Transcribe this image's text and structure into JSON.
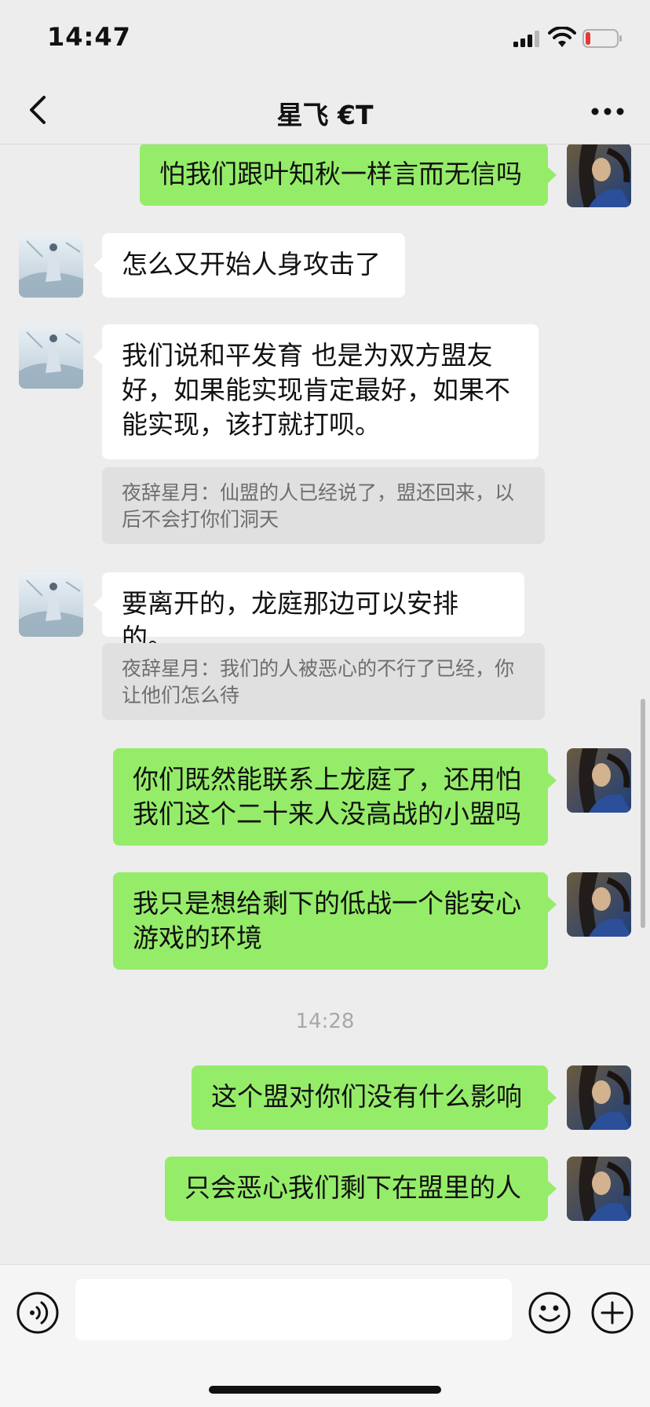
{
  "status_bar": {
    "time": "14:47"
  },
  "header": {
    "title": "星飞 €T"
  },
  "colors": {
    "background": "#ededed",
    "outgoing_bubble": "#95ec69",
    "incoming_bubble": "#ffffff",
    "quote_background": "#e0e0e0",
    "battery_low": "#e53935"
  },
  "icons": {
    "back": "chevron-left-icon",
    "more": "more-dots-icon",
    "voice": "voice-icon",
    "emoji": "emoji-smile-icon",
    "plus": "plus-icon"
  },
  "messages": [
    {
      "sender": "me",
      "text": "怕我们跟叶知秋一样言而无信吗"
    },
    {
      "sender": "other",
      "text": "怎么又开始人身攻击了"
    },
    {
      "sender": "other",
      "text": "我们说和平发育 也是为双方盟友好，如果能实现肯定最好，如果不能实现，该打就打呗。",
      "quote": "夜辞星月：仙盟的人已经说了，盟还回来，以后不会打你们洞天"
    },
    {
      "sender": "other",
      "text": "要离开的，龙庭那边可以安排的。",
      "quote": "夜辞星月：我们的人被恶心的不行了已经，你让他们怎么待"
    },
    {
      "sender": "me",
      "text": "你们既然能联系上龙庭了，还用怕我们这个二十来人没高战的小盟吗"
    },
    {
      "sender": "me",
      "text": "我只是想给剩下的低战一个能安心游戏的环境"
    },
    {
      "type": "timestamp",
      "text": "14:28"
    },
    {
      "sender": "me",
      "text": "这个盟对你们没有什么影响"
    },
    {
      "sender": "me",
      "text": "只会恶心我们剩下在盟里的人"
    }
  ],
  "input": {
    "value": "",
    "placeholder": ""
  }
}
